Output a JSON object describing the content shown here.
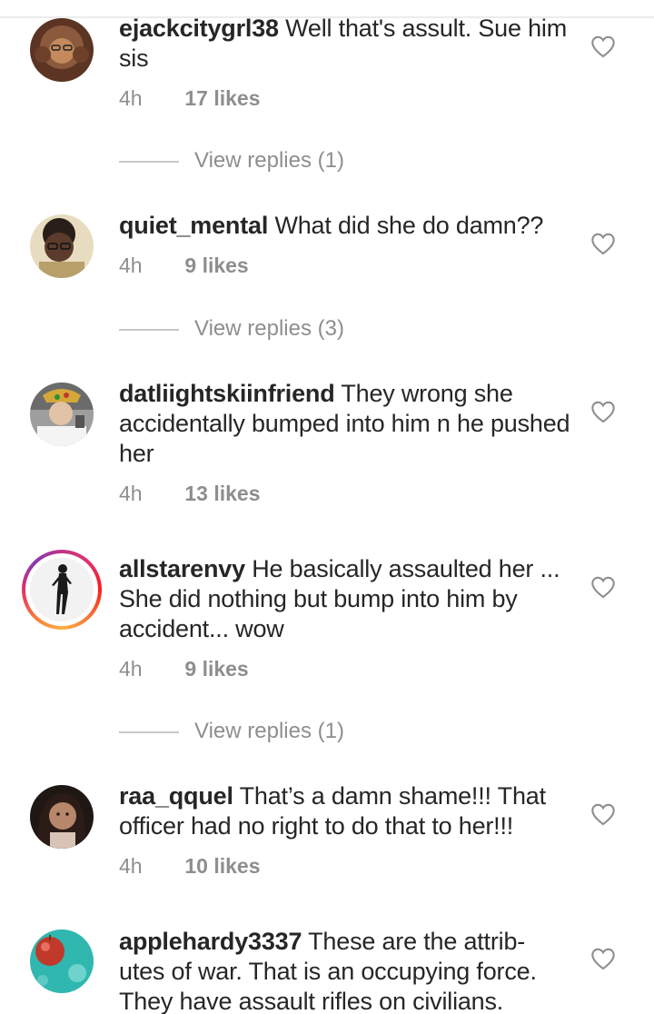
{
  "comments": [
    {
      "username": "ejackcitygrl38",
      "text": "Well that's assult. Sue him sis",
      "time": "4h",
      "likes": "17 likes",
      "replies": "View replies (1)",
      "avatar_color": "#8b5a3c"
    },
    {
      "username": "quiet_mental",
      "text": "What did she do damn??",
      "time": "4h",
      "likes": "9 likes",
      "replies": "View replies (3)",
      "avatar_color": "#d9c28a"
    },
    {
      "username": "datliightskiinfriend",
      "text": "They wrong she accidentally bumped into him n he pushed her",
      "time": "4h",
      "likes": "13 likes",
      "avatar_color": "#c9b8a6"
    },
    {
      "username": "allstarenvy",
      "text": "He basically assaulted her ... She did nothing but bump into him by accident... wow",
      "time": "4h",
      "likes": "9 likes",
      "replies": "View replies (1)",
      "avatar_color": "#f2f2f2"
    },
    {
      "username": "raa_qquel",
      "text": "That’s a damn shame!!! That officer had no right to do that to her!!!",
      "time": "4h",
      "likes": "10 likes",
      "avatar_color": "#3a2a26"
    },
    {
      "username": "applehardy3337",
      "text": "These are the attrib- utes of war. That is an occupying force. They have assault rifles on civilians.",
      "avatar_color": "#2fb7b0"
    }
  ],
  "icons": {
    "like": "heart-outline-icon"
  },
  "colors": {
    "text": "#262626",
    "secondary": "#8e8e8e",
    "divider": "#c7c7c7"
  }
}
